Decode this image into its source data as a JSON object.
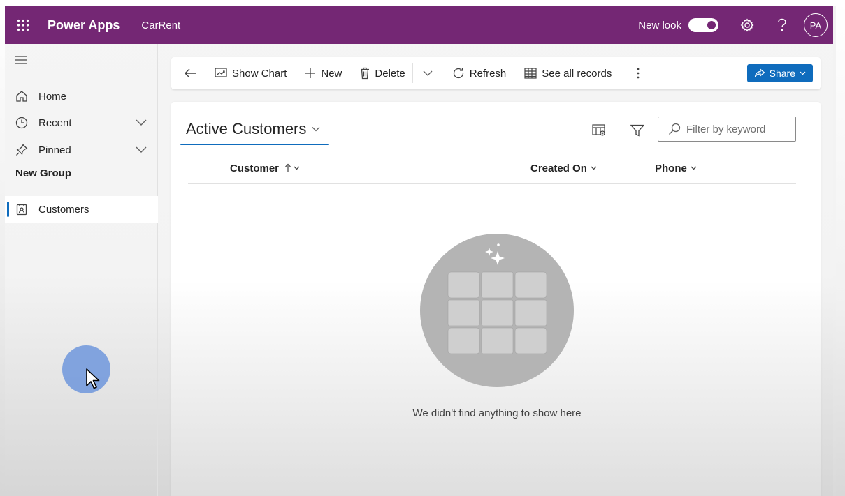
{
  "header": {
    "app_name": "Power Apps",
    "environment": "CarRent",
    "new_look_label": "New look",
    "new_look_on": true,
    "avatar_initials": "PA",
    "brand_color": "#742774"
  },
  "sidebar": {
    "items": [
      {
        "label": "Home",
        "icon": "home-icon"
      },
      {
        "label": "Recent",
        "icon": "clock-icon"
      },
      {
        "label": "Pinned",
        "icon": "pin-icon"
      }
    ],
    "group_label": "New Group",
    "group_items": [
      {
        "label": "Customers",
        "icon": "contact-card-icon",
        "selected": true
      }
    ]
  },
  "commandbar": {
    "show_chart": "Show Chart",
    "new": "New",
    "delete": "Delete",
    "refresh": "Refresh",
    "see_all": "See all records",
    "share": "Share"
  },
  "view": {
    "title": "Active Customers",
    "filter_placeholder": "Filter by keyword",
    "columns": [
      "Customer",
      "Created On",
      "Phone"
    ],
    "empty_message": "We didn't find anything to show here",
    "accent": "#0f6cbd"
  }
}
